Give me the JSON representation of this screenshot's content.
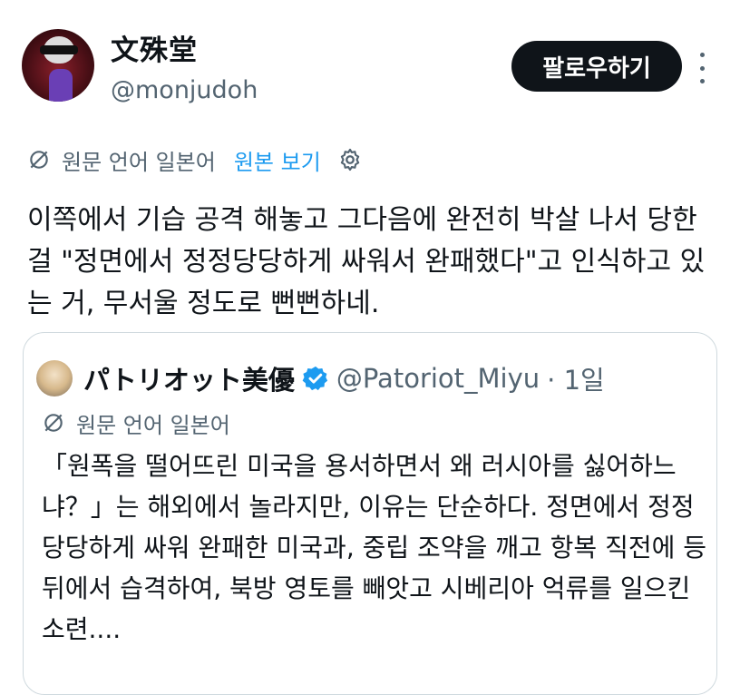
{
  "author": {
    "display_name": "文殊堂",
    "handle": "@monjudoh"
  },
  "follow_label": "팔로우하기",
  "translation": {
    "original_language": "원문 언어 일본어",
    "view_original": "원본 보기"
  },
  "tweet_text": "이쪽에서 기습 공격 해놓고 그다음에 완전히 박살 나서 당한 걸 \"정면에서 정정당당하게 싸워서 완패했다\"고 인식하고 있는 거, 무서울 정도로 뻔뻔하네.",
  "quoted": {
    "display_name": "パトリオット美優",
    "handle": "@Patoriot_Miyu",
    "time": "· 1일",
    "original_language": "원문 언어 일본어",
    "text": "「원폭을 떨어뜨린 미국을 용서하면서 왜 러시아를 싫어하느냐？」는 해외에서 놀라지만, 이유는 단순하다. 정면에서 정정당당하게 싸워 완패한 미국과, 중립 조약을 깨고 항복 직전에 등 뒤에서 습격하여, 북방 영토를 빼앗고 시베리아 억류를 일으킨 소련...."
  },
  "colors": {
    "accent": "#1d9bf0",
    "text": "#0f1419",
    "secondary": "#536471",
    "button_bg": "#0f1419"
  },
  "icons": [
    "more-icon",
    "translate-icon",
    "gear-icon",
    "verified-badge-icon"
  ]
}
